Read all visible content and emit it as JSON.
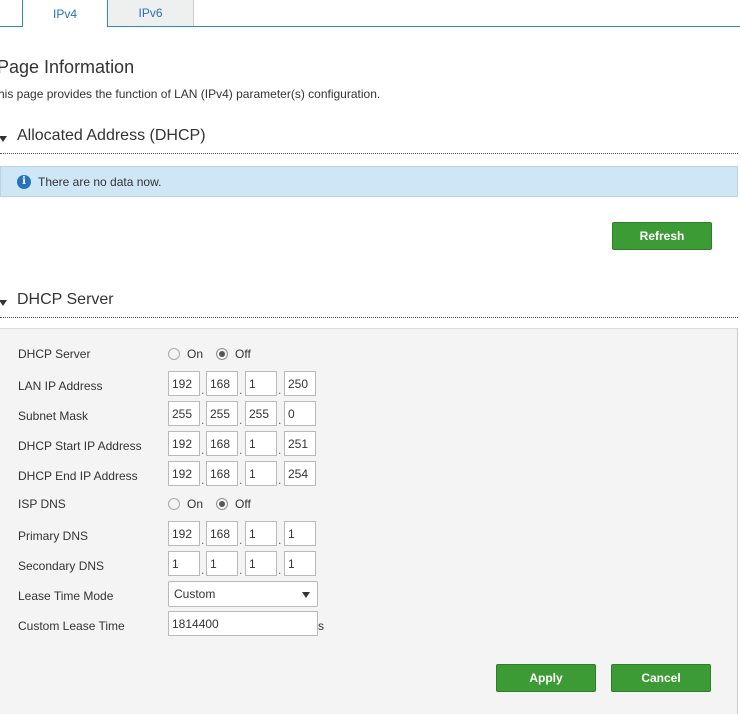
{
  "tabs": [
    {
      "label": "IPv4",
      "active": true
    },
    {
      "label": "IPv6",
      "active": false
    }
  ],
  "page": {
    "title": "Page Information",
    "description": "his page provides the function of LAN (IPv4) parameter(s) configuration."
  },
  "allocated": {
    "heading": "Allocated Address (DHCP)",
    "info_icon": "info-icon",
    "empty_text": "There are no data now.",
    "refresh_label": "Refresh"
  },
  "dhcp": {
    "heading": "DHCP Server",
    "rows": {
      "dhcp_server": {
        "label": "DHCP Server",
        "on": "On",
        "off": "Off",
        "selected": "Off"
      },
      "lan_ip": {
        "label": "LAN IP Address",
        "octets": [
          "192",
          "168",
          "1",
          "250"
        ]
      },
      "subnet": {
        "label": "Subnet Mask",
        "octets": [
          "255",
          "255",
          "255",
          "0"
        ]
      },
      "start_ip": {
        "label": "DHCP Start IP Address",
        "octets": [
          "192",
          "168",
          "1",
          "251"
        ]
      },
      "end_ip": {
        "label": "DHCP End IP Address",
        "octets": [
          "192",
          "168",
          "1",
          "254"
        ]
      },
      "isp_dns": {
        "label": "ISP DNS",
        "on": "On",
        "off": "Off",
        "selected": "Off"
      },
      "primary_dns": {
        "label": "Primary DNS",
        "octets": [
          "192",
          "168",
          "1",
          "1"
        ]
      },
      "secondary_dns": {
        "label": "Secondary DNS",
        "octets": [
          "1",
          "1",
          "1",
          "1"
        ]
      },
      "lease_mode": {
        "label": "Lease Time Mode",
        "value": "Custom"
      },
      "custom_lease": {
        "label": "Custom Lease Time",
        "value": "1814400",
        "unit": "s"
      }
    },
    "apply_label": "Apply",
    "cancel_label": "Cancel"
  },
  "colors": {
    "accent_button": "#3d9b35",
    "info_background": "#cfe6f7",
    "tab_border": "#2e8fa3",
    "tab_text": "#2a6fb5"
  }
}
